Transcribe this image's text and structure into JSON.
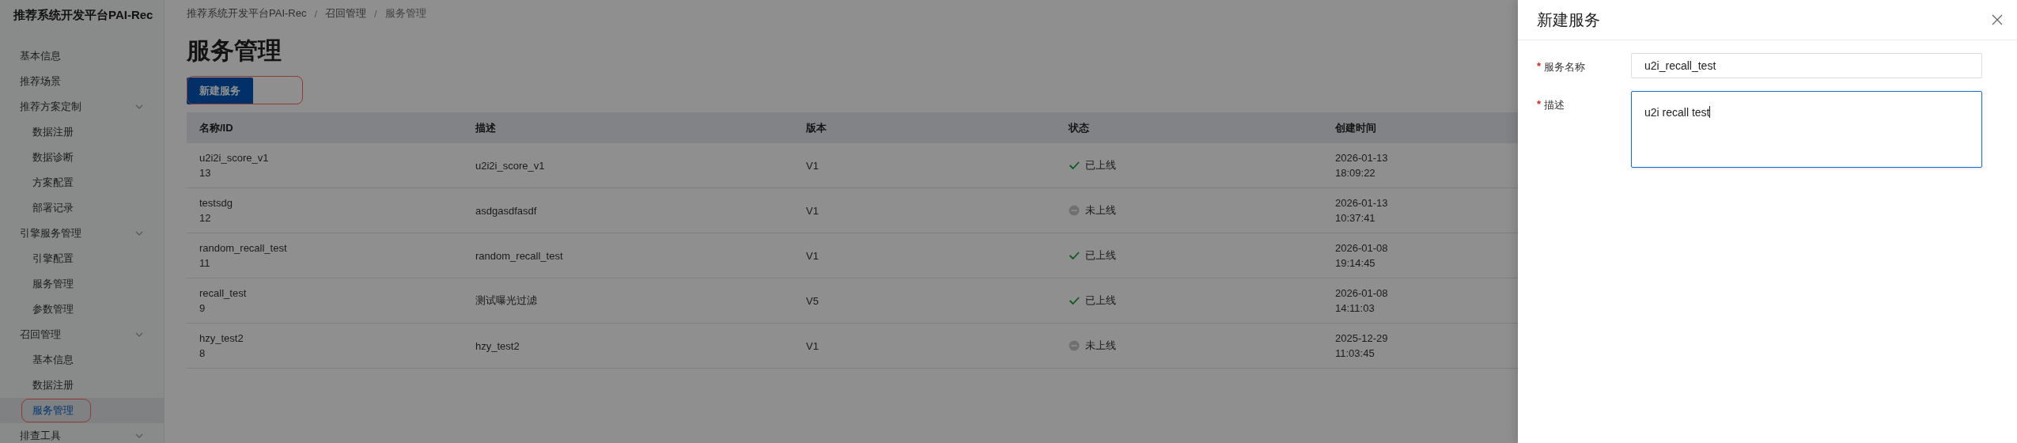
{
  "sidebar": {
    "title": "推荐系统开发平台PAI-Rec",
    "items": [
      {
        "label": "基本信息",
        "selected": false,
        "annotated": false
      },
      {
        "label": "推荐场景",
        "selected": false,
        "annotated": false
      },
      {
        "label": "推荐方案定制",
        "selected": false,
        "annotated": false,
        "expanded": true,
        "children": [
          {
            "label": "数据注册",
            "selected": false,
            "annotated": false
          },
          {
            "label": "数据诊断",
            "selected": false,
            "annotated": false
          },
          {
            "label": "方案配置",
            "selected": false,
            "annotated": false
          },
          {
            "label": "部署记录",
            "selected": false,
            "annotated": false
          }
        ]
      },
      {
        "label": "引擎服务管理",
        "selected": false,
        "annotated": false,
        "expanded": true,
        "children": [
          {
            "label": "引擎配置",
            "selected": false,
            "annotated": false
          },
          {
            "label": "服务管理",
            "selected": false,
            "annotated": false
          },
          {
            "label": "参数管理",
            "selected": false,
            "annotated": false
          }
        ]
      },
      {
        "label": "召回管理",
        "selected": false,
        "annotated": false,
        "expanded": true,
        "children": [
          {
            "label": "基本信息",
            "selected": false,
            "annotated": false
          },
          {
            "label": "数据注册",
            "selected": false,
            "annotated": false
          },
          {
            "label": "服务管理",
            "selected": true,
            "annotated": true
          }
        ]
      },
      {
        "label": "排查工具",
        "selected": false,
        "annotated": false,
        "expanded": true
      }
    ]
  },
  "breadcrumb": [
    {
      "kind": "link",
      "text": "推荐系统开发平台PAI-Rec"
    },
    {
      "kind": "separator",
      "text": "/"
    },
    {
      "kind": "link",
      "text": "召回管理"
    },
    {
      "kind": "separator",
      "text": "/"
    },
    {
      "kind": "current",
      "text": "服务管理"
    }
  ],
  "page_title": "服务管理",
  "new_button": {
    "label": "新建服务",
    "annotated": true
  },
  "table": {
    "columns": [
      "名称/ID",
      "描述",
      "版本",
      "状态",
      "创建时间"
    ],
    "rows": [
      {
        "name": "u2i2i_score_v1",
        "id": "13",
        "description": "u2i2i_score_v1",
        "version": "V1",
        "status": {
          "label": "已上线",
          "online": true
        },
        "created": [
          "2026-01-13",
          "18:09:22"
        ]
      },
      {
        "name": "testsdg",
        "id": "12",
        "description": "asdgasdfasdf",
        "version": "V1",
        "status": {
          "label": "未上线",
          "online": false
        },
        "created": [
          "2026-01-13",
          "10:37:41"
        ]
      },
      {
        "name": "random_recall_test",
        "id": "11",
        "description": "random_recall_test",
        "version": "V1",
        "status": {
          "label": "已上线",
          "online": true
        },
        "created": [
          "2026-01-08",
          "19:14:45"
        ]
      },
      {
        "name": "recall_test",
        "id": "9",
        "description": "测试曝光过滤",
        "version": "V5",
        "status": {
          "label": "已上线",
          "online": true
        },
        "created": [
          "2026-01-08",
          "14:11:03"
        ]
      },
      {
        "name": "hzy_test2",
        "id": "8",
        "description": "hzy_test2",
        "version": "V1",
        "status": {
          "label": "未上线",
          "online": false
        },
        "created": [
          "2025-12-29",
          "11:03:45"
        ]
      }
    ]
  },
  "drawer": {
    "title": "新建服务",
    "fields": [
      {
        "kind": "input",
        "label": "服务名称",
        "required_mark": "*",
        "value": "u2i_recall_test",
        "focused": false
      },
      {
        "kind": "textarea",
        "label": "描述",
        "required_mark": "*",
        "value": "u2i recall test",
        "focused": true
      }
    ]
  }
}
